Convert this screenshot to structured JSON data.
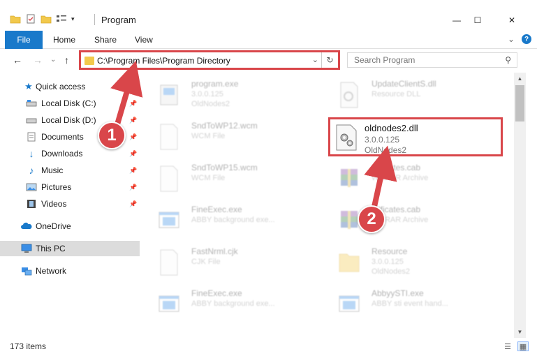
{
  "window": {
    "title": "Program",
    "minimize_glyph": "—",
    "maximize_glyph": "☐",
    "close_glyph": "✕"
  },
  "ribbon": {
    "tabs": [
      "File",
      "Home",
      "Share",
      "View"
    ],
    "collapse_glyph": "⌄",
    "help_glyph": "?"
  },
  "address_bar": {
    "path": "C:\\Program Files\\Program Directory",
    "dropdown_glyph": "⌄",
    "refresh_glyph": "↻"
  },
  "search": {
    "placeholder": "Search Program",
    "icon_glyph": "⚲"
  },
  "nav": {
    "back": "←",
    "forward": "→",
    "recent": "⌄",
    "up": "↑"
  },
  "sidebar": {
    "items": [
      {
        "label": "Quick access",
        "icon": "star-icon",
        "pinned": false
      },
      {
        "label": "Local Disk (C:)",
        "icon": "drive-icon",
        "pinned": true
      },
      {
        "label": "Local Disk (D:)",
        "icon": "drive-icon",
        "pinned": true
      },
      {
        "label": "Documents",
        "icon": "documents-icon",
        "pinned": true
      },
      {
        "label": "Downloads",
        "icon": "downloads-icon",
        "pinned": true
      },
      {
        "label": "Music",
        "icon": "music-icon",
        "pinned": true
      },
      {
        "label": "Pictures",
        "icon": "pictures-icon",
        "pinned": true
      },
      {
        "label": "Videos",
        "icon": "videos-icon",
        "pinned": true
      },
      {
        "label": "OneDrive",
        "icon": "cloud-icon",
        "pinned": false
      },
      {
        "label": "This PC",
        "icon": "computer-icon",
        "pinned": false
      },
      {
        "label": "Network",
        "icon": "network-icon",
        "pinned": false
      }
    ],
    "pin_glyph": "📌"
  },
  "files": [
    {
      "name": "program.exe",
      "l2": "3.0.0.125",
      "l3": "OldNodes2",
      "icon": "exe-icon"
    },
    {
      "name": "UpdateClientS.dll",
      "l2": "Resource DLL",
      "l3": "",
      "icon": "dll-icon"
    },
    {
      "name": "SndToWP12.wcm",
      "l2": "WCM File",
      "l3": "",
      "icon": "blank-file-icon"
    },
    {
      "name": "oldnodes2.dll",
      "l2": "3.0.0.125",
      "l3": "OldNodes2",
      "icon": "dll-gear-icon"
    },
    {
      "name": "SndToWP15.wcm",
      "l2": "WCM File",
      "l3": "",
      "icon": "blank-file-icon"
    },
    {
      "name": "...ificates.cab",
      "l2": "WinRAR Archive",
      "l3": "",
      "icon": "winrar-icon"
    },
    {
      "name": "FineExec.exe",
      "l2": "ABBY background exe...",
      "l3": "",
      "icon": "window-icon"
    },
    {
      "name": "...ificates.cab",
      "l2": "WinRAR Archive",
      "l3": "",
      "icon": "winrar-icon"
    },
    {
      "name": "FastNrml.cjk",
      "l2": "CJK File",
      "l3": "",
      "icon": "blank-file-icon"
    },
    {
      "name": "Resource",
      "l2": "3.0.0.125",
      "l3": "OldNodes2",
      "icon": "folder-icon"
    },
    {
      "name": "FineExec.exe",
      "l2": "ABBY background exe...",
      "l3": "",
      "icon": "window-icon"
    },
    {
      "name": "AbbyySTI.exe",
      "l2": "ABBY sti event hand...",
      "l3": "",
      "icon": "window-icon"
    }
  ],
  "status": {
    "item_count": "173 items"
  },
  "callouts": [
    "1",
    "2"
  ],
  "colors": {
    "accent": "#1979ca",
    "highlight": "#d9464a"
  }
}
